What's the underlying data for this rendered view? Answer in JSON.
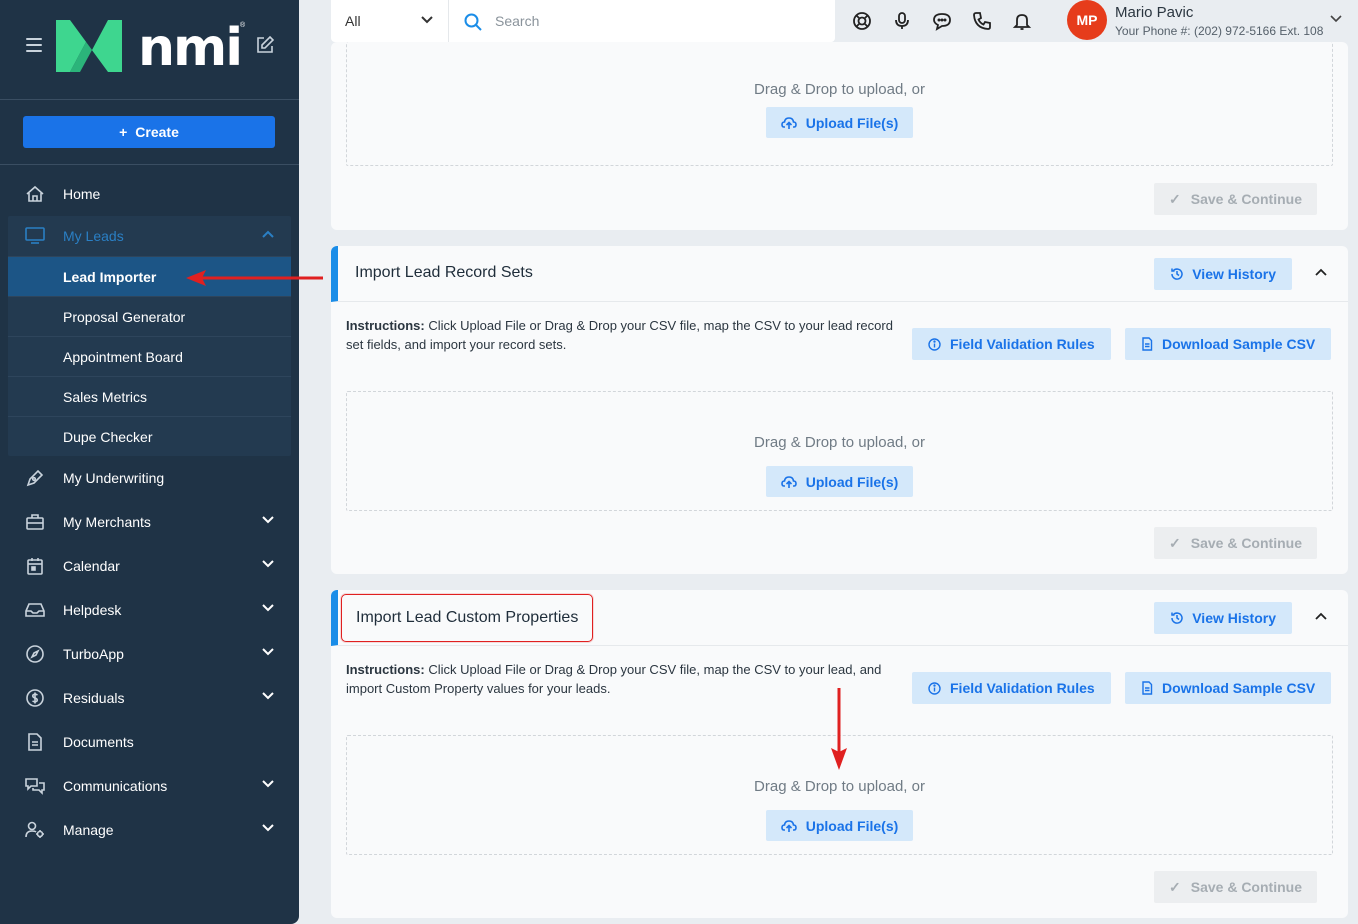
{
  "sidebar": {
    "brand": "nmi",
    "create_label": "Create",
    "items": [
      {
        "label": "Home",
        "icon": "home-icon"
      },
      {
        "label": "My Underwriting",
        "icon": "pen-icon"
      },
      {
        "label": "My Merchants",
        "icon": "briefcase-icon"
      },
      {
        "label": "Calendar",
        "icon": "calendar-icon"
      },
      {
        "label": "Helpdesk",
        "icon": "inbox-icon"
      },
      {
        "label": "TurboApp",
        "icon": "compass-icon"
      },
      {
        "label": "Residuals",
        "icon": "dollar-icon"
      },
      {
        "label": "Documents",
        "icon": "document-icon"
      },
      {
        "label": "Communications",
        "icon": "chat-icon"
      },
      {
        "label": "Manage",
        "icon": "users-gear-icon"
      }
    ],
    "leads_group": {
      "label": "My Leads",
      "subitems": [
        "Lead Importer",
        "Proposal Generator",
        "Appointment Board",
        "Sales Metrics",
        "Dupe Checker"
      ]
    }
  },
  "topbar": {
    "scope": "All",
    "search_placeholder": "Search",
    "user_initials": "MP",
    "user_name": "Mario Pavic",
    "user_phone": "Your Phone #: (202) 972-5166 Ext. 108"
  },
  "main": {
    "dz_text": "Drag & Drop to upload, or",
    "upload_label": "Upload File(s)",
    "save_label": "Save & Continue",
    "view_history_label": "View History",
    "field_rules_label": "Field Validation Rules",
    "sample_csv_label": "Download Sample CSV",
    "instructions_prefix": "Instructions:",
    "card2": {
      "title": "Import Lead Record Sets",
      "instructions": "Click Upload File or Drag & Drop your CSV file, map the CSV to your lead record set fields, and import your record sets."
    },
    "card3": {
      "title": "Import Lead Custom Properties",
      "instructions": "Click Upload File or Drag & Drop your CSV file, map the CSV to your lead, and import Custom Property values for your leads."
    }
  },
  "colors": {
    "sidebar_bg": "#1f3346",
    "accent": "#1a73e8",
    "avatar": "#e63c1b",
    "annotation": "#e02020"
  }
}
